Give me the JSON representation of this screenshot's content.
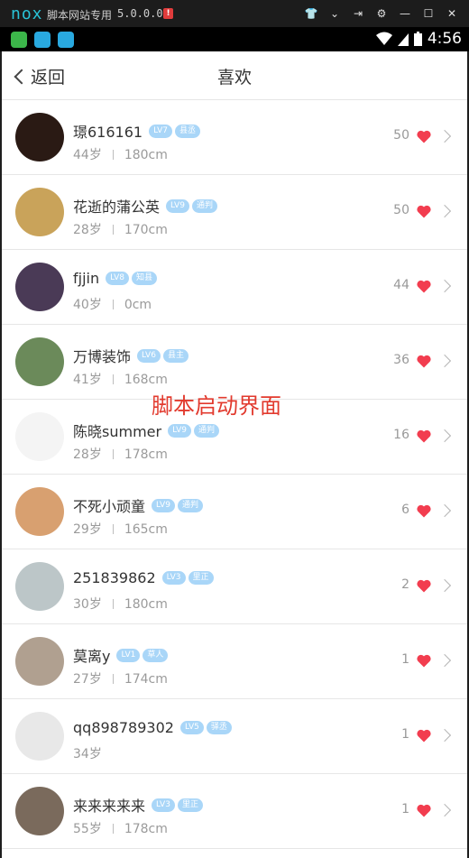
{
  "emulator": {
    "logo": "nox",
    "title": "脚本网站专用",
    "version": "5.0.0.0",
    "badge": "!"
  },
  "status_bar": {
    "time": "4:56"
  },
  "nav": {
    "back_label": "返回",
    "title": "喜欢"
  },
  "overlay_text": "脚本启动界面",
  "users": [
    {
      "name": "璟616161",
      "level": "LV7",
      "tag": "县丞",
      "age": "44岁",
      "height": "180cm",
      "likes": "50"
    },
    {
      "name": "花逝的蒲公英",
      "level": "LV9",
      "tag": "通判",
      "age": "28岁",
      "height": "170cm",
      "likes": "50"
    },
    {
      "name": "fjjin",
      "level": "LV8",
      "tag": "知县",
      "age": "40岁",
      "height": "0cm",
      "likes": "44"
    },
    {
      "name": "万博装饰",
      "level": "LV6",
      "tag": "县主",
      "age": "41岁",
      "height": "168cm",
      "likes": "36"
    },
    {
      "name": "陈晓summer",
      "level": "LV9",
      "tag": "通判",
      "age": "28岁",
      "height": "178cm",
      "likes": "16"
    },
    {
      "name": "不死小顽童",
      "level": "LV9",
      "tag": "通判",
      "age": "29岁",
      "height": "165cm",
      "likes": "6"
    },
    {
      "name": "251839862",
      "level": "LV3",
      "tag": "里正",
      "age": "30岁",
      "height": "180cm",
      "likes": "2"
    },
    {
      "name": "莫离y",
      "level": "LV1",
      "tag": "草人",
      "age": "27岁",
      "height": "174cm",
      "likes": "1"
    },
    {
      "name": "qq898789302",
      "level": "LV5",
      "tag": "驿丞",
      "age": "34岁",
      "height": "",
      "likes": "1"
    },
    {
      "name": "来来来来来",
      "level": "LV3",
      "tag": "里正",
      "age": "55岁",
      "height": "178cm",
      "likes": "1"
    }
  ],
  "colors": {
    "heart": "#f23d4f",
    "tag_bg": "#a9d6f8",
    "overlay": "#e23a2e"
  }
}
